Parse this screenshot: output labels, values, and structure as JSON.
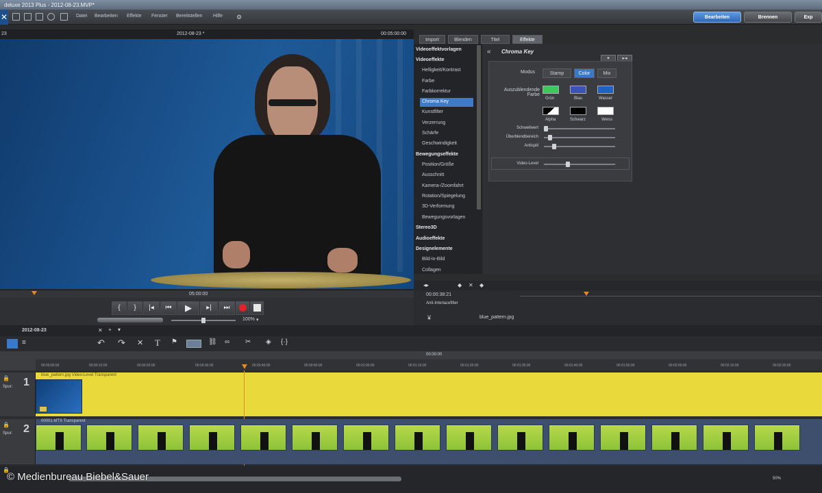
{
  "titlebar": {
    "title": "deluxe 2013 Plus - 2012-08-23.MVP*"
  },
  "menu": {
    "items": [
      "Datei",
      "Bearbeiten",
      "Effekte",
      "Fenster",
      "Bereitstellen",
      "Hilfe"
    ]
  },
  "modes": {
    "edit": "Bearbeiten",
    "burn": "Brennen",
    "export": "Exp"
  },
  "preview": {
    "left_label": "23",
    "title": "2012-08-23 *",
    "timecode": "00:05:00:00",
    "ruler_time": "05:00:00",
    "zoom": "100%"
  },
  "tabs": {
    "import": "Import",
    "fades": "Blenden",
    "title": "Titel",
    "effects": "Effekte"
  },
  "effects_tree": {
    "templates": "Videoeffektvorlagen",
    "video": "Videoeffekte",
    "video_items": [
      "Helligkeit/Kontrast",
      "Farbe",
      "Farbkorrektur",
      "Chroma Key",
      "Kunstfilter",
      "Verzerrung",
      "Schärfe",
      "Geschwindigkeit"
    ],
    "motion": "Bewegungseffekte",
    "motion_items": [
      "Position/Größe",
      "Ausschnitt",
      "Kamera-/Zoomfahrt",
      "Rotation/Spiegelung",
      "3D-Verformung",
      "Bewegungsvorlagen"
    ],
    "stereo": "Stereo3D",
    "audio": "Audioeffekte",
    "design": "Designelemente",
    "design_items": [
      "Bild-in-Bild",
      "Collagen"
    ]
  },
  "chroma": {
    "title": "Chroma Key",
    "mode_label": "Modus",
    "modes": [
      "Stamp",
      "Color",
      "Mix"
    ],
    "hide_color_label": "Auszublendende Farbe",
    "colors": [
      "Grün",
      "Blau",
      "Wasser",
      "Alpha",
      "Schwarz",
      "Weiss"
    ],
    "sliders": [
      "Schwellwert",
      "Überblendbereich",
      "Antispill"
    ],
    "video_level": "Video-Level"
  },
  "right_timeline": {
    "timecode": "00:00:38:21",
    "filter": "Anti-Interlacefilter",
    "filename": "blue_pattern.jpg"
  },
  "timeline": {
    "project": "2012-08-23",
    "center_time": "00:00:00",
    "ticks": [
      "00:00:00:00",
      "00:00:10:00",
      "00:00:20:00",
      "00:00:30:00",
      "00:00:40:00",
      "00:00:50:00",
      "00:01:00:00",
      "00:01:10:00",
      "00:01:20:00",
      "00:01:30:00",
      "00:01:40:00",
      "00:01:50:00",
      "00:02:00:00",
      "00:02:10:00",
      "00:02:20:00"
    ],
    "track_label": "Spur:",
    "track1": {
      "num": "1",
      "clip": "blue_pattern.jpg  Video-Level Transparent"
    },
    "track2": {
      "num": "2",
      "clip": "00001.MTS Transparent"
    },
    "zoom": "50%"
  },
  "copyright": "© Medienbureau Biebel&Sauer",
  "colors": {
    "accent": "#3a78c9",
    "track1": "#ead93a",
    "record": "#e0222a",
    "playhead": "#e8862a"
  }
}
